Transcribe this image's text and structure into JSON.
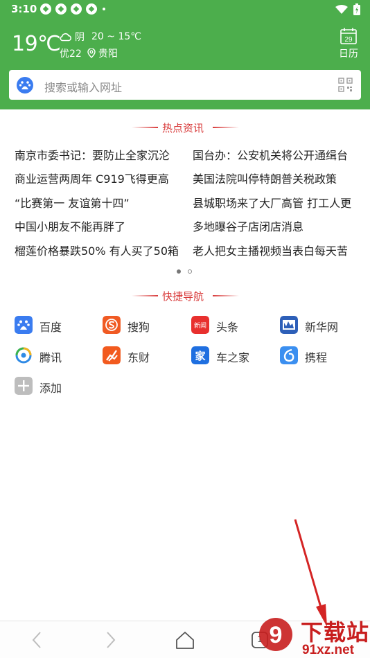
{
  "status_bar": {
    "time": "3:10"
  },
  "weather": {
    "temperature": "19℃",
    "condition": "阴",
    "temp_range": "20 ~ 15℃",
    "air_quality": "优22",
    "location": "贵阳"
  },
  "calendar": {
    "day": "29",
    "label": "日历"
  },
  "search": {
    "placeholder": "搜索或输入网址"
  },
  "hot_news": {
    "title": "热点资讯",
    "items": [
      {
        "text": "南京市委书记：要防止全家沉沦"
      },
      {
        "text": "国台办：公安机关将公开通缉台"
      },
      {
        "text": "商业运营两周年 C919飞得更高"
      },
      {
        "text": "美国法院叫停特朗普关税政策"
      },
      {
        "text": "“比赛第一 友谊第十四”"
      },
      {
        "text": "县城职场来了大厂高管 打工人更"
      },
      {
        "text": "中国小朋友不能再胖了"
      },
      {
        "text": "多地曝谷子店闭店消息"
      },
      {
        "text": "榴莲价格暴跌50% 有人买了50箱"
      },
      {
        "text": "老人把女主播视频当表白每天苦"
      }
    ]
  },
  "quick_nav": {
    "title": "快捷导航",
    "items": [
      {
        "label": "百度",
        "icon": "baidu-icon",
        "color": "#3a7cf0"
      },
      {
        "label": "搜狗",
        "icon": "sogou-icon",
        "color": "#f05a23"
      },
      {
        "label": "头条",
        "icon": "toutiao-icon",
        "color": "#e8302e",
        "badge": "新闻"
      },
      {
        "label": "新华网",
        "icon": "xinhua-icon",
        "color": "#2d5fb8"
      },
      {
        "label": "腾讯",
        "icon": "tencent-icon",
        "color": "#2f8ae5"
      },
      {
        "label": "东财",
        "icon": "dongcai-icon",
        "color": "#f25a1e"
      },
      {
        "label": "车之家",
        "icon": "autohome-icon",
        "color": "#1f6fe0",
        "badge": "家"
      },
      {
        "label": "携程",
        "icon": "ctrip-icon",
        "color": "#3b8ff0"
      },
      {
        "label": "添加",
        "icon": "add-icon",
        "color": "#bdbdbd"
      }
    ]
  },
  "bottom_nav": {
    "tab_count": "1"
  },
  "watermark": {
    "text1": "下载站",
    "text2": "91xz.net"
  }
}
